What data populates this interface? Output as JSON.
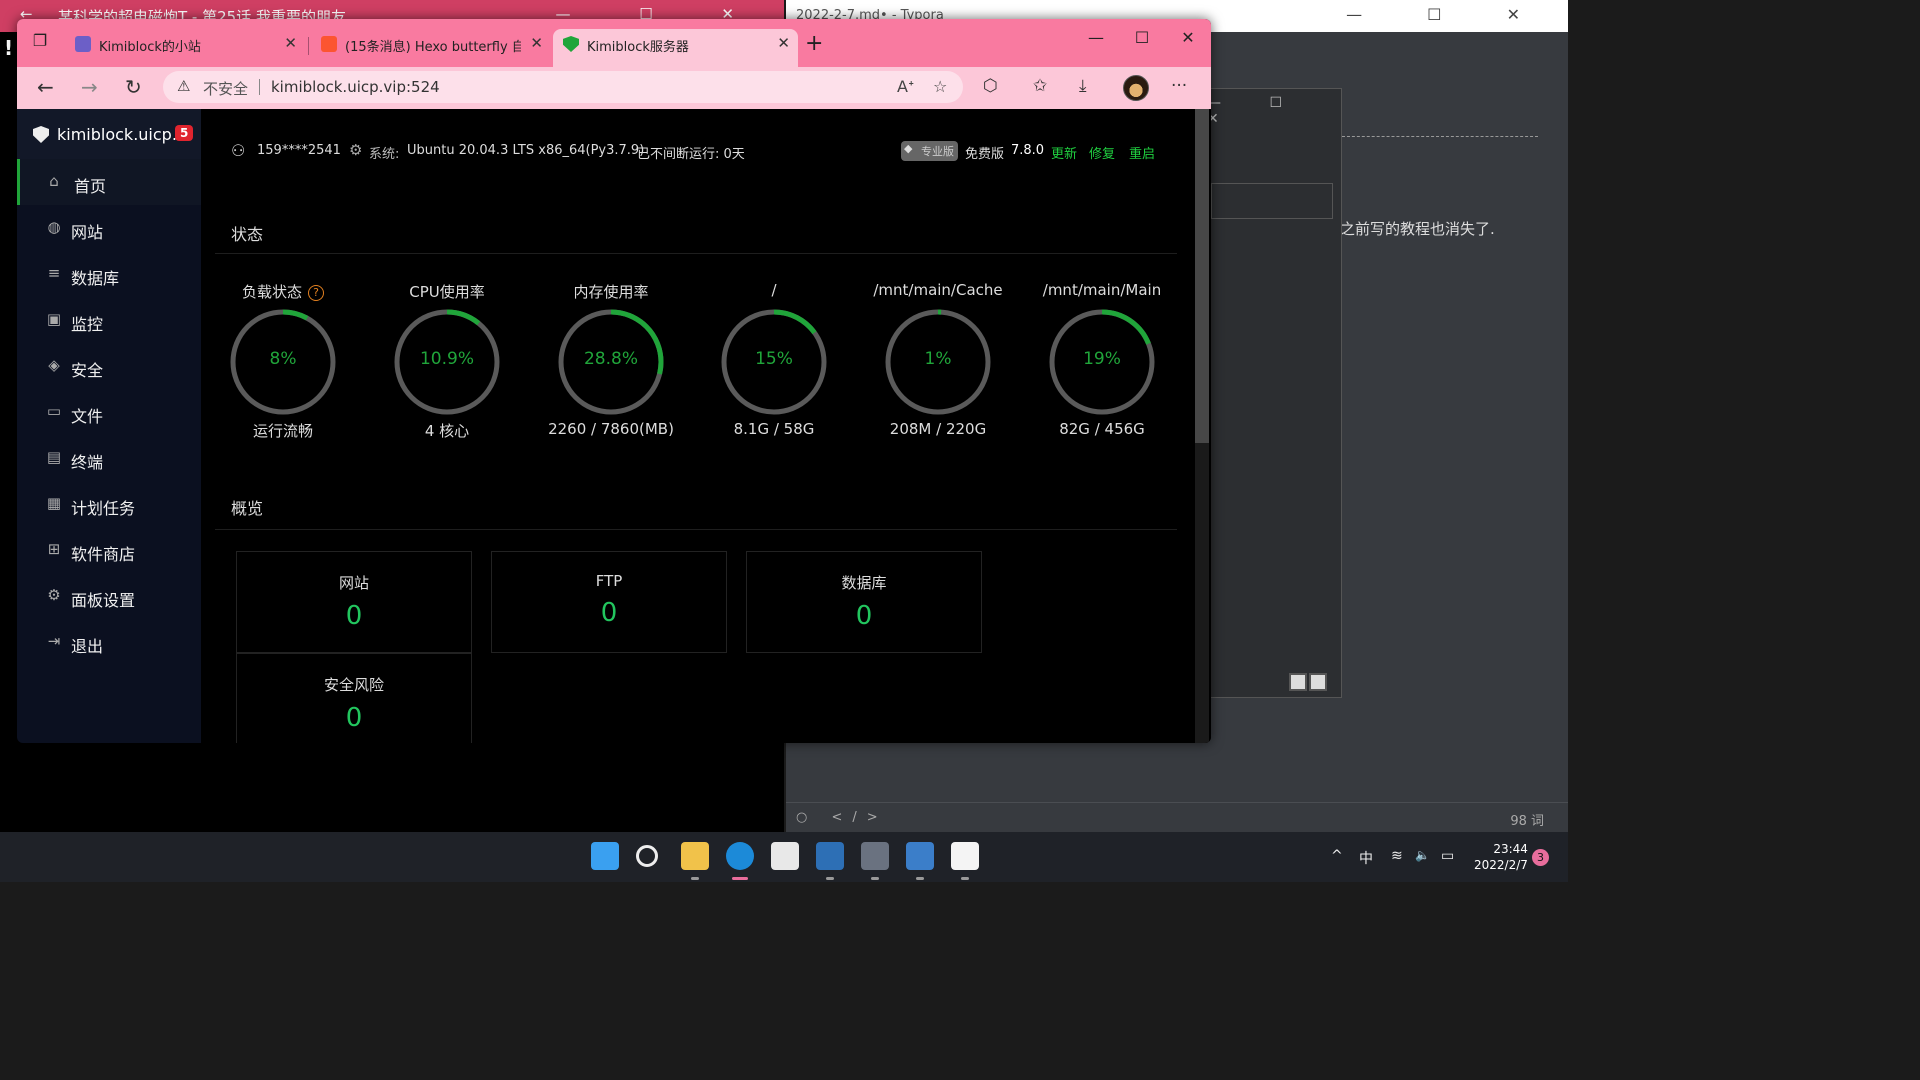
{
  "bg_left": {
    "title": "某科学的超电磁炮T - 第25话 我重要的朋友",
    "back": "←",
    "ctrls": "— ☐ ✕",
    "excl": "!"
  },
  "bg_right": {
    "title": "2022-2-7.md• - Typora",
    "ctrls": "— ☐ ✕",
    "doc_text": "之前写的教程也消失了.",
    "status_left": "○ </>",
    "word_count": "98 词"
  },
  "dialog": {
    "ctrls": "— ☐ ✕"
  },
  "browser": {
    "tabs": [
      {
        "title": "Kimiblock的小站",
        "favicon_color": "#6c5fc7"
      },
      {
        "title": "(15条消息) Hexo butterfly 自定义",
        "favicon_color": "#fc5531"
      },
      {
        "title": "Kimiblock服务器",
        "favicon_color": "#20a53a"
      }
    ],
    "tab_close": "✕",
    "tab_actions_icon": "❐",
    "new_tab": "+",
    "win_minimize": "—",
    "win_maximize": "☐",
    "win_close": "✕",
    "nav": {
      "back": "←",
      "forward": "→",
      "reload": "↻"
    },
    "address": {
      "warn_icon": "⚠",
      "insecure": "不安全",
      "url": "kimiblock.uicp.vip:524"
    },
    "tools": {
      "read_aloud": "Aᐩ",
      "favorite_add": "☆",
      "extensions": "⬡",
      "favorites": "✩",
      "download": "⤓",
      "more": "···"
    }
  },
  "sidebar": {
    "site_name": "kimiblock.uicp....",
    "badge": "5",
    "items": [
      {
        "label": "首页",
        "icon": "⌂"
      },
      {
        "label": "网站",
        "icon": "◍"
      },
      {
        "label": "数据库",
        "icon": "≡"
      },
      {
        "label": "监控",
        "icon": "▣"
      },
      {
        "label": "安全",
        "icon": "◈"
      },
      {
        "label": "文件",
        "icon": "▭"
      },
      {
        "label": "终端",
        "icon": "▤"
      },
      {
        "label": "计划任务",
        "icon": "▦"
      },
      {
        "label": "软件商店",
        "icon": "⊞"
      },
      {
        "label": "面板设置",
        "icon": "⚙"
      },
      {
        "label": "退出",
        "icon": "⇥"
      }
    ]
  },
  "topinfo": {
    "user_icon": "⚇",
    "user": "159****2541",
    "sys_icon": "⚙",
    "sys_label": "系统:",
    "system": "Ubuntu 20.04.3 LTS x86_64(Py3.7.9)",
    "uptime": "已不间断运行: 0天",
    "pro": "专业版",
    "pro_icon": "◆",
    "free": "免费版",
    "version": "7.8.0",
    "update": "更新",
    "repair": "修复",
    "restart": "重启"
  },
  "status": {
    "title": "状态",
    "help": "?",
    "gauges": [
      {
        "label": "负载状态",
        "pct": "8%",
        "value": 0.08,
        "sub": "运行流畅"
      },
      {
        "label": "CPU使用率",
        "pct": "10.9%",
        "value": 0.109,
        "sub": "4 核心"
      },
      {
        "label": "内存使用率",
        "pct": "28.8%",
        "value": 0.288,
        "sub": "2260 / 7860(MB)"
      },
      {
        "label": "/",
        "pct": "15%",
        "value": 0.15,
        "sub": "8.1G / 58G"
      },
      {
        "label": "/mnt/main/Cache",
        "pct": "1%",
        "value": 0.01,
        "sub": "208M / 220G"
      },
      {
        "label": "/mnt/main/Main",
        "pct": "19%",
        "value": 0.19,
        "sub": "82G / 456G"
      }
    ]
  },
  "overview": {
    "title": "概览",
    "cards": [
      {
        "name": "网站",
        "value": "0"
      },
      {
        "name": "FTP",
        "value": "0"
      },
      {
        "name": "数据库",
        "value": "0"
      },
      {
        "name": "安全风险",
        "value": "0"
      }
    ]
  },
  "colors": {
    "accent_green": "#20a53a",
    "tab_pink": "#f97aa0",
    "address_pink": "#fcc7d8"
  },
  "taskbar": {
    "apps": [
      "start-icon",
      "search-icon",
      "file-explorer-icon",
      "edge-icon",
      "store-icon",
      "monitor-app-icon",
      "settings-icon",
      "app-icon",
      "typora-icon"
    ],
    "tray_up": "^",
    "ime": "中",
    "wifi": "≋",
    "volume": "🔈",
    "battery": "▭",
    "time": "23:44",
    "date": "2022/2/7",
    "notifications": "3"
  }
}
